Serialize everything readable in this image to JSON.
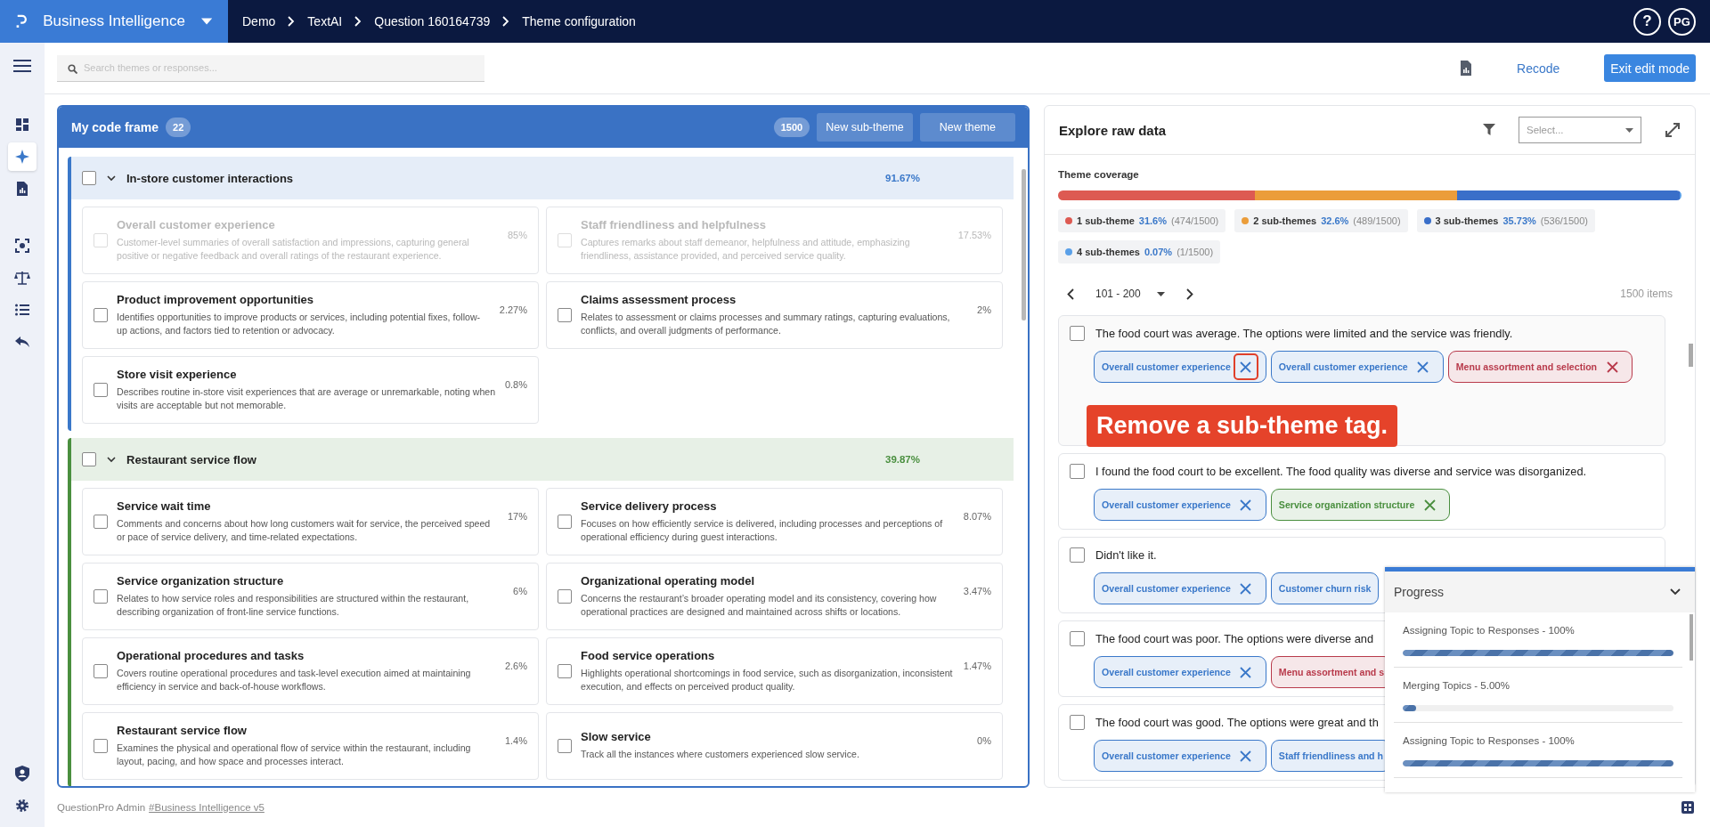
{
  "app": {
    "name": "Business Intelligence"
  },
  "breadcrumb": [
    "Demo",
    "TextAI",
    "Question 160164739",
    "Theme configuration"
  ],
  "header": {
    "help": "?",
    "avatar": "PG"
  },
  "nav": [
    {
      "kind": "dashboard",
      "selected": false
    },
    {
      "kind": "sparkle",
      "selected": true
    },
    {
      "kind": "report",
      "selected": false
    },
    {
      "kind": "scan",
      "selected": false
    },
    {
      "kind": "scale",
      "selected": false
    },
    {
      "kind": "list",
      "selected": false
    },
    {
      "kind": "reply",
      "selected": false
    }
  ],
  "nav_bottom": [
    {
      "kind": "user-shield",
      "selected": false
    },
    {
      "kind": "gear",
      "selected": false
    }
  ],
  "search": {
    "placeholder": "Search themes or responses..."
  },
  "toolbar": {
    "recode": "Recode",
    "exit": "Exit edit mode"
  },
  "code_frame": {
    "title": "My code frame",
    "count": "22",
    "total": "1500",
    "new_subtheme": "New sub-theme",
    "new_theme": "New theme",
    "themes": [
      {
        "name": "In-store customer interactions",
        "percent": "91.67%",
        "color": "#3a78c9",
        "checked": false,
        "expanded": true,
        "subthemes": [
          {
            "name": "Overall customer experience",
            "description": "Customer-level summaries of overall satisfaction and impressions, capturing general positive or negative feedback and overall ratings of the restaurant experience.",
            "percent": "85%",
            "disabled": true,
            "checked": false
          },
          {
            "name": "Staff friendliness and helpfulness",
            "description": "Captures remarks about staff demeanor, helpfulness and attitude, emphasizing friendliness, assistance provided, and perceived service quality.",
            "percent": "17.53%",
            "disabled": true,
            "checked": false
          },
          {
            "name": "Product improvement opportunities",
            "description": "Identifies opportunities to improve products or services, including potential fixes, follow-up actions, and factors tied to retention or advocacy.",
            "percent": "2.27%",
            "disabled": false,
            "checked": false
          },
          {
            "name": "Claims assessment process",
            "description": "Relates to assessment or claims processes and summary ratings, capturing evaluations, conflicts, and overall judgments of performance.",
            "percent": "2%",
            "disabled": false,
            "checked": false
          },
          {
            "name": "Store visit experience",
            "description": "Describes routine in-store visit experiences that are average or unremarkable, noting when visits are acceptable but not memorable.",
            "percent": "0.8%",
            "disabled": false,
            "checked": false
          }
        ]
      },
      {
        "name": "Restaurant service flow",
        "percent": "39.87%",
        "color": "#4a8f3f",
        "checked": false,
        "expanded": true,
        "subthemes": [
          {
            "name": "Service wait time",
            "description": "Comments and concerns about how long customers wait for service, the perceived speed or pace of service delivery, and time-related expectations.",
            "percent": "17%",
            "disabled": false,
            "checked": false
          },
          {
            "name": "Service delivery process",
            "description": "Focuses on how efficiently service is delivered, including processes and perceptions of operational efficiency during guest interactions.",
            "percent": "8.07%",
            "disabled": false,
            "checked": false
          },
          {
            "name": "Service organization structure",
            "description": "Relates to how service roles and responsibilities are structured within the restaurant, describing organization of front-line service functions.",
            "percent": "6%",
            "disabled": false,
            "checked": false
          },
          {
            "name": "Organizational operating model",
            "description": "Concerns the restaurant’s broader operating model and its consistency, covering how operational practices are designed and maintained across shifts or locations.",
            "percent": "3.47%",
            "disabled": false,
            "checked": false
          },
          {
            "name": "Operational procedures and tasks",
            "description": "Covers routine operational procedures and task-level execution aimed at maintaining efficiency in service and back-of-house workflows.",
            "percent": "2.6%",
            "disabled": false,
            "checked": false
          },
          {
            "name": "Food service operations",
            "description": "Highlights operational shortcomings in food service, such as disorganization, inconsistent execution, and effects on perceived product quality.",
            "percent": "1.47%",
            "disabled": false,
            "checked": false
          },
          {
            "name": "Restaurant service flow",
            "description": "Examines the physical and operational flow of service within the restaurant, including layout, pacing, and how space and processes interact.",
            "percent": "1.4%",
            "disabled": false,
            "checked": false
          },
          {
            "name": "Slow service",
            "description": "Track all the instances where customers experienced slow service.",
            "percent": "0%",
            "disabled": false,
            "checked": false
          }
        ]
      }
    ]
  },
  "explore": {
    "title": "Explore raw data",
    "select_placeholder": "Select...",
    "coverage_title": "Theme coverage",
    "coverage": [
      {
        "label": "1 sub-theme",
        "percent": "31.6%",
        "count": "(474/1500)",
        "color": "#dd5a52"
      },
      {
        "label": "2 sub-themes",
        "percent": "32.6%",
        "count": "(489/1500)",
        "color": "#eb9d3a"
      },
      {
        "label": "3 sub-themes",
        "percent": "35.73%",
        "count": "(536/1500)",
        "color": "#3a6fc9"
      },
      {
        "label": "4 sub-themes",
        "percent": "0.07%",
        "count": "(1/1500)",
        "color": "#5aa0e8"
      }
    ],
    "pager": {
      "range": "101 - 200",
      "items": "1500 items"
    },
    "responses": [
      {
        "text": "The food court was average. The options were limited and the service was friendly.",
        "checked": false,
        "tags": [
          {
            "label": "Overall customer experience",
            "color": "#3a78c9",
            "highlighted": true
          },
          {
            "label": "Overall customer experience",
            "color": "#3a78c9",
            "highlighted": false
          },
          {
            "label": "Menu assortment and selection",
            "color": "#b83a4b",
            "highlighted": false
          }
        ]
      },
      {
        "text": "I found the food court to be excellent. The food quality was diverse and service was disorganized.",
        "checked": false,
        "tags": [
          {
            "label": "Overall customer experience",
            "color": "#3a78c9",
            "highlighted": false
          },
          {
            "label": "Service organization structure",
            "color": "#4a8f3f",
            "highlighted": false
          }
        ]
      },
      {
        "text": "Didn't like it.",
        "checked": false,
        "tags": [
          {
            "label": "Overall customer experience",
            "color": "#3a78c9",
            "highlighted": false
          },
          {
            "label": "Customer churn risk",
            "color": "#3a78c9"
          }
        ]
      },
      {
        "text": "The food court was poor. The options were diverse and",
        "checked": false,
        "tags": [
          {
            "label": "Overall customer experience",
            "color": "#3a78c9",
            "highlighted": false
          },
          {
            "label": "Menu assortment and s",
            "color": "#b83a4b"
          }
        ]
      },
      {
        "text": "The food court was good. The options were great and th",
        "checked": false,
        "tags": [
          {
            "label": "Overall customer experience",
            "color": "#3a78c9",
            "highlighted": false
          },
          {
            "label": "Staff friendliness and h",
            "color": "#3a78c9"
          }
        ]
      }
    ]
  },
  "callout": {
    "text": "Remove a sub-theme tag."
  },
  "progress": {
    "title": "Progress",
    "expanded": true,
    "tasks": [
      {
        "label": "Assigning Topic to Responses - 100%",
        "level": 1
      },
      {
        "label": "Merging Topics - 5.00%",
        "level": 0.05
      },
      {
        "label": "Assigning Topic to Responses - 100%",
        "level": 1
      }
    ]
  },
  "footer": {
    "text": "QuestionPro Admin",
    "link": "#Business Intelligence v5"
  }
}
